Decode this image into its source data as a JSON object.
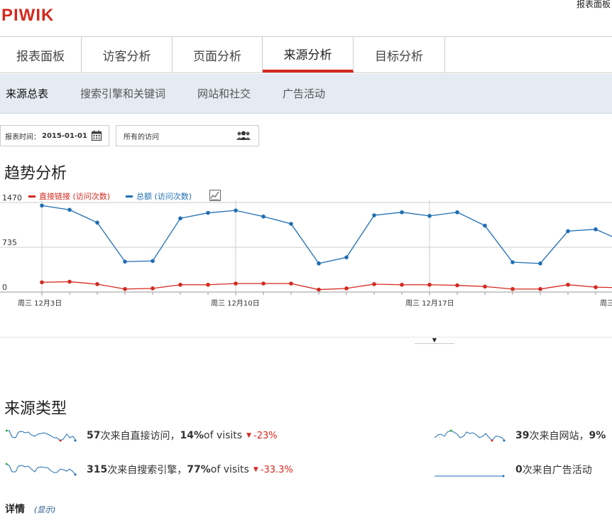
{
  "header": {
    "logo": "PIWIK",
    "top_right": "报表面板"
  },
  "main_nav": [
    {
      "label": "报表面板"
    },
    {
      "label": "访客分析"
    },
    {
      "label": "页面分析"
    },
    {
      "label": "来源分析",
      "active": true
    },
    {
      "label": "目标分析"
    }
  ],
  "sub_nav": [
    {
      "label": "来源总表",
      "active": true
    },
    {
      "label": "搜索引擎和关键词"
    },
    {
      "label": "网站和社交"
    },
    {
      "label": "广告活动"
    }
  ],
  "filters": {
    "date_label": "报表时间：",
    "date_value": "2015-01-01",
    "segment": "所有的访问"
  },
  "trend": {
    "title": "趋势分析",
    "legend": [
      {
        "name": "直接链接 (访问次数)",
        "color": "#d4291f"
      },
      {
        "name": "总额 (访问次数)",
        "color": "#1f6eb3"
      }
    ]
  },
  "chart_data": {
    "type": "line",
    "ylim": [
      0,
      1470
    ],
    "yticks": [
      "1470",
      "735",
      "0"
    ],
    "xtick_labels": [
      "周三 12月3日",
      "周三 12月10日",
      "周三 12月17日",
      "周三"
    ],
    "grid": true,
    "series": [
      {
        "name": "总额 (访问次数)",
        "color": "#1f6eb3",
        "values": [
          1420,
          1350,
          1140,
          500,
          510,
          1210,
          1300,
          1340,
          1240,
          1120,
          470,
          570,
          1260,
          1310,
          1250,
          1310,
          1090,
          490,
          470,
          1000,
          1030,
          830
        ]
      },
      {
        "name": "直接链接 (访问次数)",
        "color": "#d4291f",
        "values": [
          160,
          170,
          130,
          50,
          60,
          120,
          120,
          140,
          140,
          140,
          40,
          60,
          130,
          120,
          120,
          110,
          90,
          50,
          50,
          120,
          80,
          70
        ]
      }
    ]
  },
  "source_types": {
    "title": "来源类型",
    "items": [
      {
        "count": "57",
        "text": " 次来自直接访问，",
        "pct": "14%",
        "of": " of visits ",
        "change": "-23%"
      },
      {
        "count": "315",
        "text": " 次来自搜索引擎，",
        "pct": "77%",
        "of": " of visits ",
        "change": "-33.3%"
      },
      {
        "count": "39",
        "text": " 次来自网站，",
        "pct": "9%"
      },
      {
        "count": "0",
        "text": " 次来自广告活动"
      }
    ]
  },
  "details": {
    "label": "详情",
    "link": "(显示)"
  }
}
